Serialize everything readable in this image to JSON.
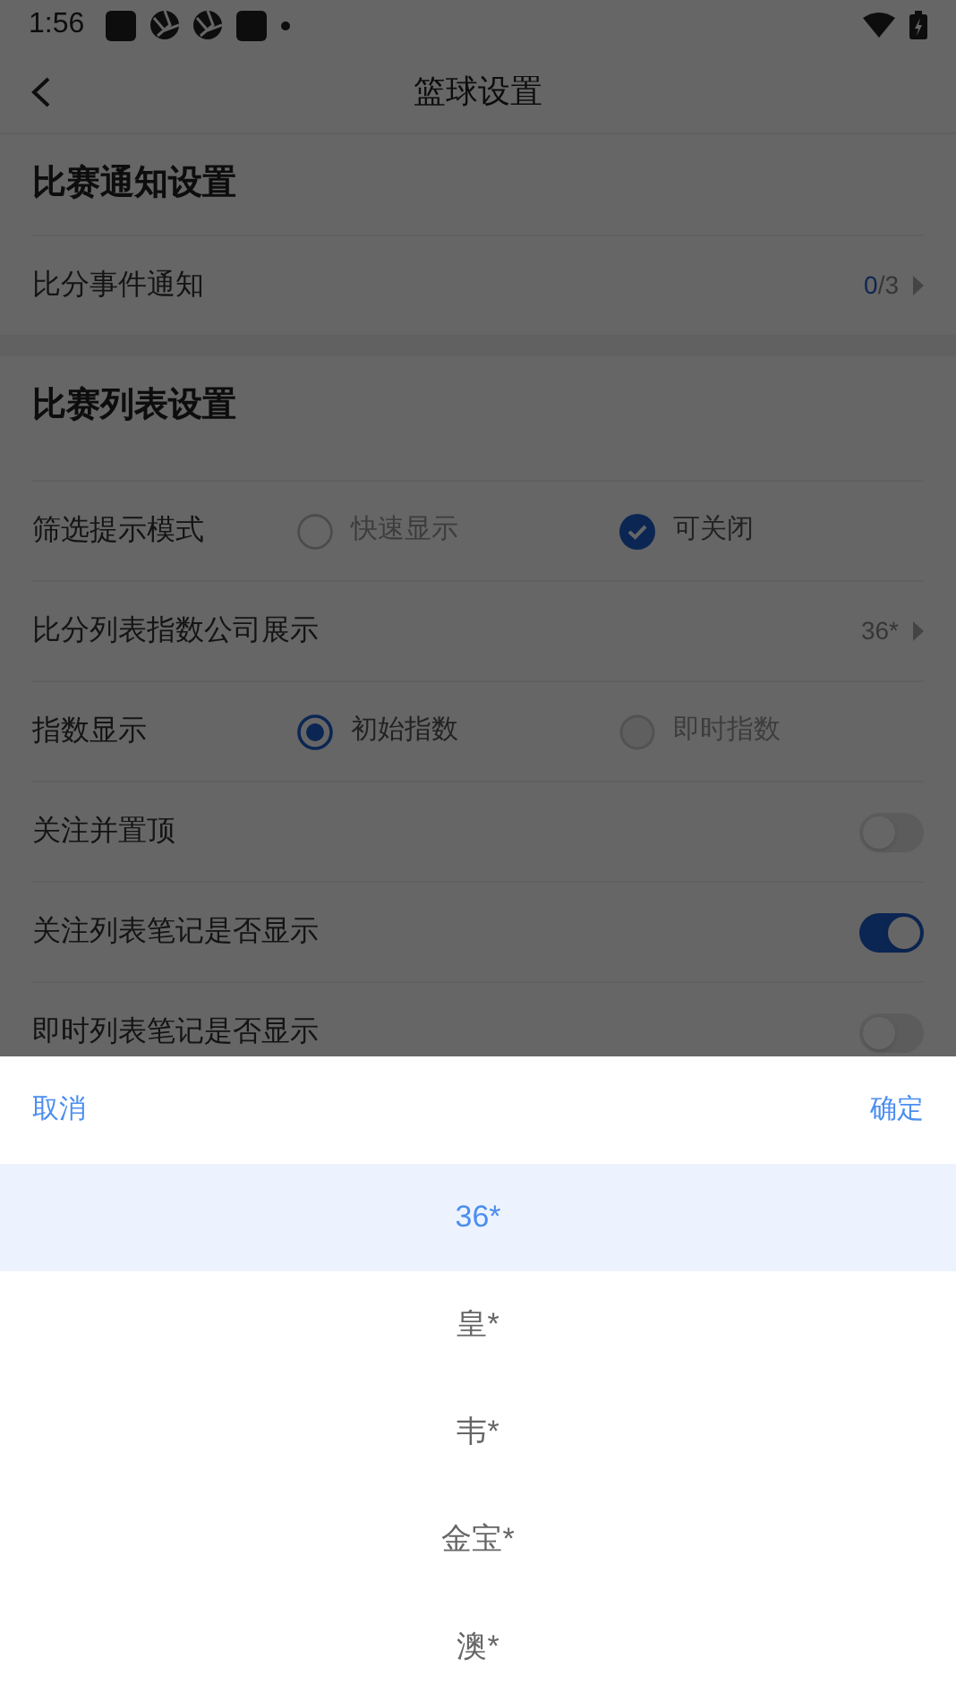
{
  "status_bar": {
    "time": "1:56"
  },
  "header": {
    "title": "篮球设置"
  },
  "sections": [
    {
      "title": "比赛通知设置",
      "rows": [
        {
          "kind": "link",
          "label": "比分事件通知",
          "value": "0",
          "suffix": "/3"
        }
      ]
    },
    {
      "title": "比赛列表设置",
      "rows": [
        {
          "kind": "check_choice",
          "label": "筛选提示模式",
          "options": [
            {
              "label": "快速显示",
              "selected": false
            },
            {
              "label": "可关闭",
              "selected": true
            }
          ]
        },
        {
          "kind": "link",
          "label": "比分列表指数公司展示",
          "suffix": "36*"
        },
        {
          "kind": "radio_choice",
          "label": "指数显示",
          "options": [
            {
              "label": "初始指数",
              "selected": true
            },
            {
              "label": "即时指数",
              "selected": false
            }
          ]
        },
        {
          "kind": "toggle",
          "label": "关注并置顶",
          "on": false
        },
        {
          "kind": "toggle",
          "label": "关注列表笔记是否显示",
          "on": true
        },
        {
          "kind": "toggle",
          "label": "即时列表笔记是否显示",
          "on": false
        }
      ]
    }
  ],
  "picker": {
    "cancel": "取消",
    "confirm": "确定",
    "options": [
      {
        "label": "36*",
        "selected": true
      },
      {
        "label": "皇*",
        "selected": false
      },
      {
        "label": "韦*",
        "selected": false
      },
      {
        "label": "金宝*",
        "selected": false
      },
      {
        "label": "澳*",
        "selected": false
      }
    ]
  }
}
